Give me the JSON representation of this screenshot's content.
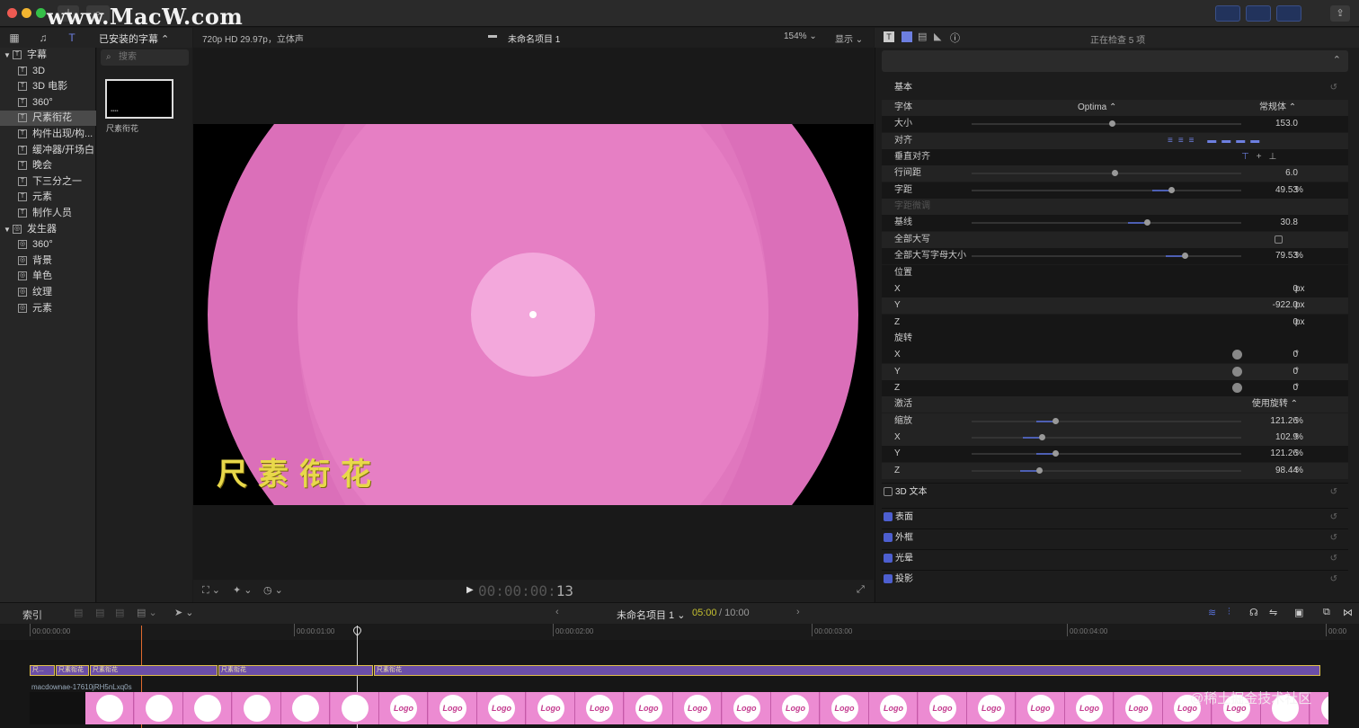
{
  "watermark": "www.MacW.com",
  "library": {
    "dropdown": "已安装的字幕",
    "search_placeholder": "搜索",
    "thumbnail_label": "尺素衔花",
    "sections": [
      {
        "label": "字幕",
        "items": [
          "3D",
          "3D 电影",
          "360°",
          "尺素衔花",
          "构件出现/构...",
          "缓冲器/开场白",
          "晚会",
          "下三分之一",
          "元素",
          "制作人员"
        ]
      },
      {
        "label": "发生器",
        "items": [
          "360°",
          "背景",
          "单色",
          "纹理",
          "元素"
        ]
      }
    ],
    "selected_item": "尺素衔花"
  },
  "viewer": {
    "format": "720p HD 29.97p，立体声",
    "project": "未命名项目 1",
    "zoom": "154%",
    "display": "显示",
    "title_text": "尺素衔花",
    "timecode_dim": "00:00:00:",
    "timecode_frame": "13"
  },
  "inspector": {
    "status": "正在检查 5 项",
    "basic": "基本",
    "rows": [
      {
        "label": "字体",
        "value": "Optima",
        "extra": "常规体"
      },
      {
        "label": "大小",
        "value": "153.0",
        "slider": 0.52
      },
      {
        "label": "对齐",
        "value": ""
      },
      {
        "label": "垂直对齐",
        "value": ""
      },
      {
        "label": "行间距",
        "value": "6.0",
        "slider": 0.53
      },
      {
        "label": "字距",
        "value": "49.53",
        "unit": "%",
        "slider": 0.74
      },
      {
        "label": "字距微调",
        "value": ""
      },
      {
        "label": "基线",
        "value": "30.8",
        "slider": 0.65
      },
      {
        "label": "全部大写",
        "value": ""
      },
      {
        "label": "全部大写字母大小",
        "value": "79.53",
        "unit": "%",
        "slider": 0.79
      },
      {
        "label": "位置",
        "value": ""
      },
      {
        "label": "X",
        "value": "0",
        "unit": "px"
      },
      {
        "label": "Y",
        "value": "-922.0",
        "unit": "px"
      },
      {
        "label": "Z",
        "value": "0",
        "unit": "px"
      },
      {
        "label": "旋转",
        "value": ""
      },
      {
        "label": "X",
        "value": "0",
        "unit": "°"
      },
      {
        "label": "Y",
        "value": "0",
        "unit": "°"
      },
      {
        "label": "Z",
        "value": "0",
        "unit": "°"
      },
      {
        "label": "激活",
        "value": "使用旋转"
      },
      {
        "label": "缩放",
        "value": "121.26",
        "unit": "%",
        "slider": 0.31
      },
      {
        "label": "X",
        "value": "102.9",
        "unit": "%",
        "slider": 0.26
      },
      {
        "label": "Y",
        "value": "121.26",
        "unit": "%",
        "slider": 0.31
      },
      {
        "label": "Z",
        "value": "98.44",
        "unit": "%",
        "slider": 0.25
      }
    ],
    "sections": [
      "3D 文本",
      "表面",
      "外框",
      "光晕",
      "投影"
    ]
  },
  "timeline": {
    "index": "索引",
    "project": "未命名项目 1",
    "time_current": "05:00",
    "time_total": "/ 10:00",
    "ruler": [
      "00:00:00:00",
      "00:00:01:00",
      "00:00:02:00",
      "00:00:03:00",
      "00:00:04:00",
      "00:00"
    ],
    "clips": [
      "尺...",
      "尺素衔花",
      "尺素衔花",
      "尺素衔花",
      "尺素衔花"
    ],
    "video_clip_name": "macdownae-17610jRH5nLxq0s",
    "frame_logo": "Logo"
  },
  "corner_watermark": "@稀土掘金技术社区"
}
